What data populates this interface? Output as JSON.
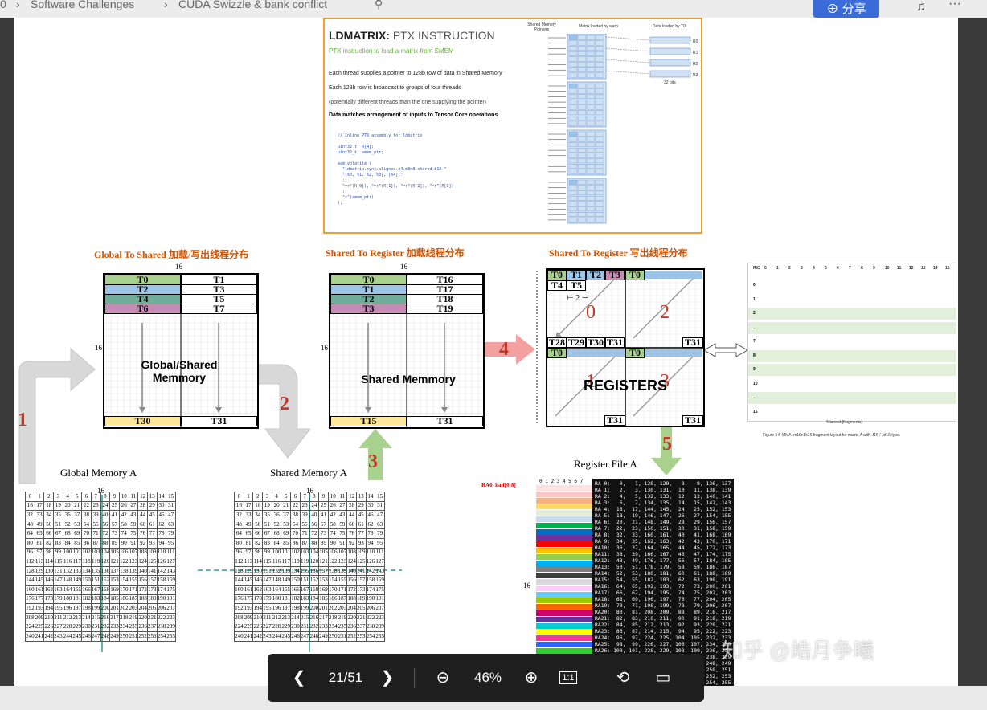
{
  "topbar": {
    "breadcrumb_0": "0",
    "breadcrumb_1": "Software Challenges",
    "breadcrumb_2": "CUDA Swizzle & bank conflict",
    "share_label": "分享"
  },
  "slide_top": {
    "title_bold": "LDMATRIX:",
    "title_rest": " PTX INSTRUCTION",
    "subtitle": "PTX instruction to load a matrix from SMEM",
    "bullet_1": "Each thread supplies a pointer to 128b row of data in Shared Memory",
    "bullet_2": "Each 128b row is broadcast to groups of four threads",
    "bullet_3": "(potentially different threads than the one supplying the pointer)",
    "bullet_4": "Data matches arrangement of inputs to Tensor Core operations",
    "code": "// Inline PTX assembly for ldmatrix\n\nuint32_t  R[4];\nuint32_t  smem_ptr;\n\nasm volatile (\n  \"ldmatrix.sync.aligned.x4.m8n8.shared.b16 \"\n  \"{%0, %1, %2, %3}, [%4];\"\n  :\n  \"=r\"(R[0]), \"=r\"(R[1]), \"=r\"(R[2]), \"=r\"(R[3])\n  :\n  \"r\"(smem_ptr)\n);",
    "col_pointers": "Shared Memory Pointers",
    "col_matrix": "Matrix loaded by warp",
    "col_data": "Data loaded by T0",
    "bits_label": "32 bits",
    "r_labels": [
      "R0",
      "R1",
      "R2",
      "R3"
    ]
  },
  "diagram": {
    "title_global": "Global To Shared 加载/写出线程分布",
    "title_s2r": "Shared To Register 加载线程分布",
    "title_s2r_write": "Shared To Register 写出线程分布",
    "global_label": "Global/Shared\nMemmory",
    "shared_label": "Shared Memmory",
    "registers_label": "REGISTERS",
    "dim_16": "16",
    "global_rows": [
      "T0",
      "T2",
      "T4",
      "T6"
    ],
    "global_rows_right": [
      "T1",
      "T3",
      "T5",
      "T7"
    ],
    "global_bottom": [
      "T30",
      "T31"
    ],
    "shared_rows": [
      "T0",
      "T1",
      "T2",
      "T3"
    ],
    "shared_rows_right": [
      "T16",
      "T17",
      "T18",
      "T19"
    ],
    "shared_bottom": [
      "T15",
      "T31"
    ],
    "reg_top": [
      "T0",
      "T1",
      "T2",
      "T3",
      "T0"
    ],
    "reg_second": [
      "T4",
      "T5"
    ],
    "reg_bottom_row": [
      "T28",
      "T29",
      "T30",
      "T31",
      "T31"
    ],
    "reg_mid_row": [
      "T0",
      "T0"
    ],
    "reg_end": [
      "T31",
      "T31"
    ],
    "step_nums": [
      "1",
      "2",
      "3",
      "4",
      "5"
    ],
    "quad_nums": [
      "0",
      "2",
      "1",
      "3"
    ],
    "two_label": "2",
    "global_mem_a": "Global Memory A",
    "shared_mem_a": "Shared Memory A",
    "register_file_a": "Register File A",
    "ra0_label": "RA0, half[0:8]",
    "fig_caption": "Figure 54: MMA .m16n8k16 fragment layout for matrix A with .f16 / .bf16 type.",
    "fragment_caption": "%laneId:{fragments}",
    "frag_headers": [
      "R\\C",
      "0",
      "1",
      "2",
      "3",
      "4",
      "5",
      "6",
      "7",
      "8",
      "9",
      "10",
      "11",
      "12",
      "13",
      "14",
      "15"
    ],
    "frag_rows": [
      "0",
      "1",
      "2",
      "..",
      "7",
      "8",
      "9",
      "10",
      "..",
      "15"
    ]
  },
  "register_lines": [
    "RA 0:   0,   1, 128, 129,   8,   9, 136, 137",
    "RA 1:   2,   3, 130, 131,  10,  11, 138, 139",
    "RA 2:   4,   5, 132, 133,  12,  13, 140, 141",
    "RA 3:   6,   7, 134, 135,  14,  15, 142, 143",
    "RA 4:  16,  17, 144, 145,  24,  25, 152, 153",
    "RA 5:  18,  19, 146, 147,  26,  27, 154, 155",
    "RA 6:  20,  21, 148, 149,  28,  29, 156, 157",
    "RA 7:  22,  23, 150, 151,  30,  31, 158, 159",
    "RA 8:  32,  33, 160, 161,  40,  41, 168, 169",
    "RA 9:  34,  35, 162, 163,  42,  43, 170, 171",
    "RA10:  36,  37, 164, 165,  44,  45, 172, 173",
    "RA11:  38,  39, 166, 167,  46,  47, 174, 175",
    "RA12:  48,  49, 176, 177,  56,  57, 184, 185",
    "RA13:  50,  51, 178, 179,  58,  59, 186, 187",
    "RA14:  52,  53, 180, 181,  60,  61, 188, 189",
    "RA15:  54,  55, 182, 183,  62,  63, 190, 191",
    "RA16:  64,  65, 192, 193,  72,  73, 200, 201",
    "RA17:  66,  67, 194, 195,  74,  75, 202, 203",
    "RA18:  68,  69, 196, 197,  76,  77, 204, 205",
    "RA19:  70,  71, 198, 199,  78,  79, 206, 207",
    "RA20:  80,  81, 208, 209,  88,  89, 216, 217",
    "RA21:  82,  83, 210, 211,  90,  91, 218, 219",
    "RA22:  84,  85, 212, 213,  92,  93, 220, 221",
    "RA23:  86,  87, 214, 215,  94,  95, 222, 223",
    "RA24:  96,  97, 224, 225, 104, 105, 232, 233",
    "RA25:  98,  99, 226, 227, 106, 107, 234, 235",
    "RA26: 100, 101, 228, 229, 108, 109, 236, 237",
    "RA27: 102, 103, 230, 231, 110, 111, 238, 239",
    "RA28: 112, 113, 240, 241, 120, 121, 248, 249",
    "RA29: 114, 115, 242, 243, 122, 123, 250, 251",
    "RA30: 116, 117, 244, 245, 124, 125, 252, 253",
    "RA31: 118, 119, 246, 247, 126, 127, 254, 255"
  ],
  "watermark": "知乎 @皓月争曦",
  "pager": {
    "page": "21/51",
    "zoom": "46%",
    "fit_label": "1:1"
  },
  "colors": {
    "green": "#a9d18e",
    "blue": "#9dc3e6",
    "teal": "#70ad9b",
    "purple": "#c58bb5",
    "yellow": "#ffe699"
  }
}
